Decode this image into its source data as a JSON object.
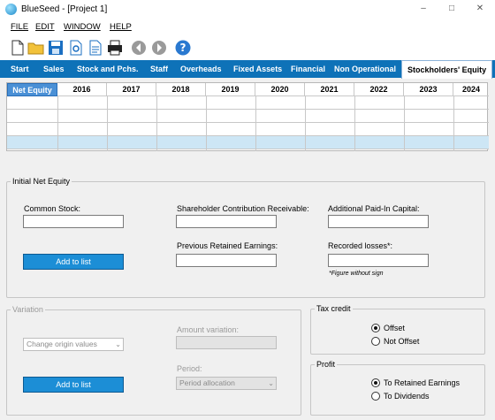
{
  "window": {
    "title": "BlueSeed - [Project 1]",
    "minimize_glyph": "–",
    "maximize_glyph": "□",
    "close_glyph": "✕"
  },
  "menu": {
    "items": [
      "FILE",
      "EDIT",
      "WINDOW",
      "HELP"
    ]
  },
  "toolbar": {
    "icons": [
      "new-file-icon",
      "open-folder-icon",
      "save-icon",
      "settings-file-icon",
      "document-icon",
      "print-icon",
      "back-icon",
      "forward-icon",
      "help-icon"
    ]
  },
  "tabs": {
    "items": [
      "Start",
      "Sales",
      "Stock and Pchs.",
      "Staff",
      "Overheads",
      "Fixed Assets",
      "Financial",
      "Non Operational",
      "Stockholders' Equity"
    ],
    "active": "Stockholders' Equity"
  },
  "grid": {
    "headers": [
      "Net Equity",
      "2016",
      "2017",
      "2018",
      "2019",
      "2020",
      "2021",
      "2022",
      "2023",
      "2024"
    ],
    "row_count": 4
  },
  "initial_net_equity": {
    "legend": "Initial Net Equity",
    "common_stock_label": "Common Stock:",
    "shareholder_label": "Shareholder Contribution Receivable:",
    "paid_in_label": "Additional Paid-In Capital:",
    "retained_label": "Previous Retained Earnings:",
    "losses_label": "Recorded losses*:",
    "add_button": "Add to list",
    "footnote": "*Figure without sign"
  },
  "variation": {
    "legend": "Variation",
    "origin_select": "Change origin values",
    "amount_label": "Amount variation:",
    "period_label": "Period:",
    "period_select": "Period allocation",
    "add_button": "Add to list"
  },
  "tax_credit": {
    "legend": "Tax credit",
    "options": [
      "Offset",
      "Not Offset"
    ],
    "selected": "Offset"
  },
  "profit": {
    "legend": "Profit",
    "options": [
      "To Retained Earnings",
      "To Dividends"
    ],
    "selected": "To Retained Earnings"
  },
  "colors": {
    "tab_bar": "#0e72b8",
    "button": "#1c8ed6",
    "selected_row": "#cde6f5",
    "grid_header": "#4a90d6"
  }
}
